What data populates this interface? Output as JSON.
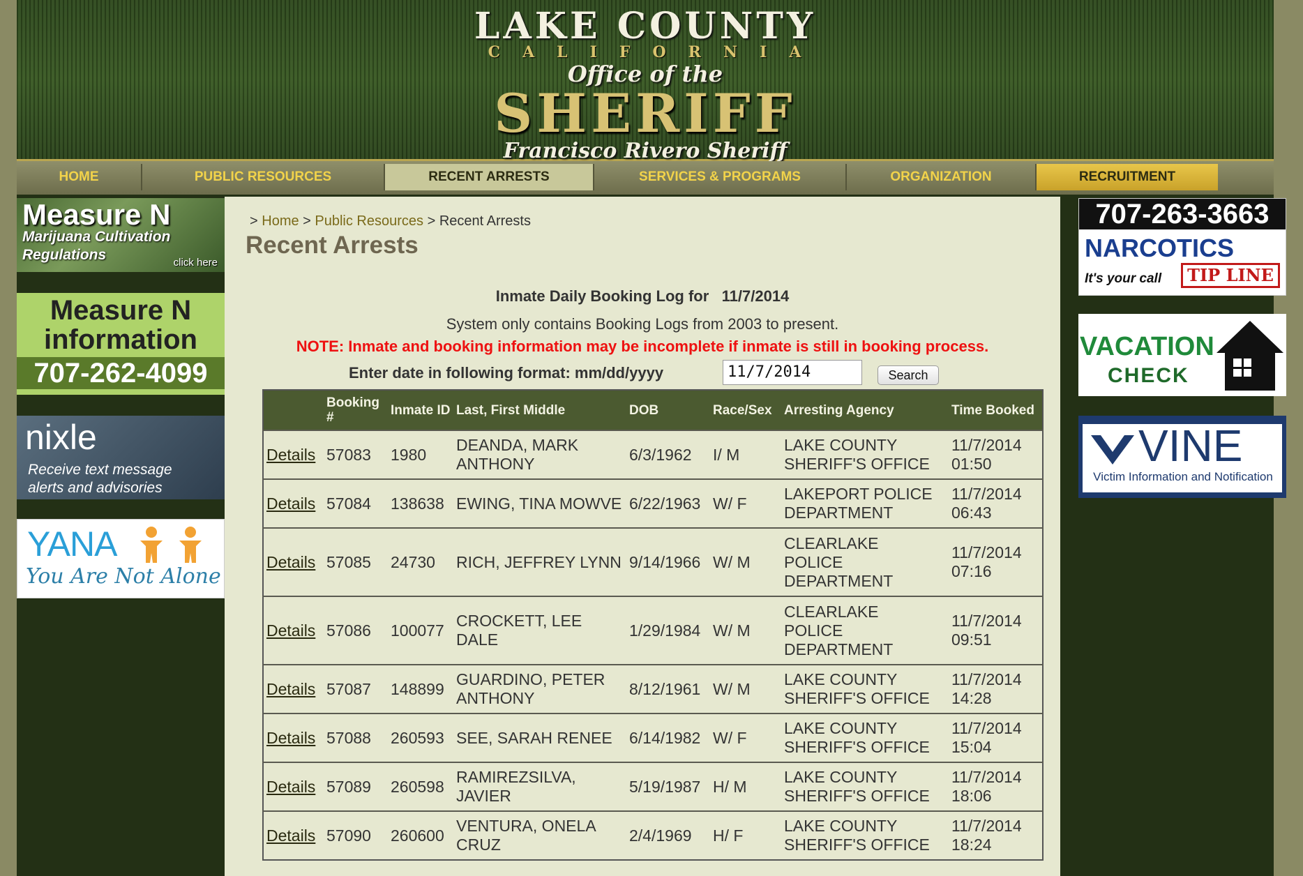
{
  "header": {
    "logo_line1": "LAKE COUNTY",
    "logo_line2": "CALIFORNIA",
    "logo_line3": "Office of the",
    "logo_line4": "SHERIFF",
    "logo_line5": "Francisco Rivero Sheriff"
  },
  "nav": {
    "items": [
      "HOME",
      "PUBLIC RESOURCES",
      "RECENT ARRESTS",
      "SERVICES & PROGRAMS",
      "ORGANIZATION",
      "RECRUITMENT"
    ],
    "active": "RECENT ARRESTS"
  },
  "ads_left": {
    "measure_n": {
      "title": "Measure N",
      "line1": "Marijuana Cultivation",
      "line2": "Regulations",
      "cta": "click here"
    },
    "measure_n_info": {
      "line1": "Measure N",
      "line2": "information",
      "phone": "707-262-4099"
    },
    "nixle": {
      "brand": "nixle",
      "line1": "Receive text message",
      "line2": "alerts and advisories"
    },
    "yana": {
      "brand": "YANA",
      "tagline": "You Are Not Alone"
    }
  },
  "ads_right": {
    "narcotics": {
      "phone": "707-263-3663",
      "title": "NARCOTICS",
      "tagline": "It's your call",
      "badge": "TIP LINE"
    },
    "vacation": {
      "line1": "VACATION",
      "line2": "CHECK"
    },
    "vine": {
      "brand": "VINE",
      "tagline": "Victim Information and Notification"
    }
  },
  "breadcrumb": {
    "home": "Home",
    "public_resources": "Public Resources",
    "current": "Recent Arrests"
  },
  "page_title": "Recent Arrests",
  "log": {
    "title_prefix": "Inmate Daily Booking Log for",
    "date": "11/7/2014",
    "subtitle": "System only contains Booking Logs from 2003 to present.",
    "note": "NOTE: Inmate and booking information may be incomplete if inmate is still in booking process.",
    "date_label": "Enter date in following format: mm/dd/yyyy",
    "date_input_value": "11/7/2014",
    "search_label": "Search"
  },
  "table": {
    "headers": [
      "",
      "Booking #",
      "Inmate ID",
      "Last, First Middle",
      "DOB",
      "Race/Sex",
      "Arresting Agency",
      "Time Booked"
    ],
    "rows": [
      {
        "link": "Details",
        "booking": "57083",
        "inmate_id": "1980",
        "name": "DEANDA, MARK ANTHONY",
        "dob": "6/3/1962",
        "race_sex": "I/ M",
        "agency": "LAKE COUNTY SHERIFF'S OFFICE",
        "date": "11/7/2014",
        "time": "01:50"
      },
      {
        "link": "Details",
        "booking": "57084",
        "inmate_id": "138638",
        "name": "EWING, TINA MOWVE",
        "dob": "6/22/1963",
        "race_sex": "W/ F",
        "agency": "LAKEPORT POLICE DEPARTMENT",
        "date": "11/7/2014",
        "time": "06:43"
      },
      {
        "link": "Details",
        "booking": "57085",
        "inmate_id": "24730",
        "name": "RICH, JEFFREY LYNN",
        "dob": "9/14/1966",
        "race_sex": "W/ M",
        "agency": "CLEARLAKE POLICE DEPARTMENT",
        "date": "11/7/2014",
        "time": "07:16"
      },
      {
        "link": "Details",
        "booking": "57086",
        "inmate_id": "100077",
        "name": "CROCKETT, LEE DALE",
        "dob": "1/29/1984",
        "race_sex": "W/ M",
        "agency": "CLEARLAKE POLICE DEPARTMENT",
        "date": "11/7/2014",
        "time": "09:51"
      },
      {
        "link": "Details",
        "booking": "57087",
        "inmate_id": "148899",
        "name": "GUARDINO, PETER ANTHONY",
        "dob": "8/12/1961",
        "race_sex": "W/ M",
        "agency": "LAKE COUNTY SHERIFF'S OFFICE",
        "date": "11/7/2014",
        "time": "14:28"
      },
      {
        "link": "Details",
        "booking": "57088",
        "inmate_id": "260593",
        "name": "SEE, SARAH RENEE",
        "dob": "6/14/1982",
        "race_sex": "W/ F",
        "agency": "LAKE COUNTY SHERIFF'S OFFICE",
        "date": "11/7/2014",
        "time": "15:04"
      },
      {
        "link": "Details",
        "booking": "57089",
        "inmate_id": "260598",
        "name": "RAMIREZSILVA, JAVIER",
        "dob": "5/19/1987",
        "race_sex": "H/ M",
        "agency": "LAKE COUNTY SHERIFF'S OFFICE",
        "date": "11/7/2014",
        "time": "18:06"
      },
      {
        "link": "Details",
        "booking": "57090",
        "inmate_id": "260600",
        "name": "VENTURA, ONELA CRUZ",
        "dob": "2/4/1969",
        "race_sex": "H/ F",
        "agency": "LAKE COUNTY SHERIFF'S OFFICE",
        "date": "11/7/2014",
        "time": "18:24"
      }
    ]
  },
  "colors": {
    "header_green": "#2f4a1e",
    "nav_text": "#f2d34a",
    "table_header": "#4b5a30",
    "content_bg": "#e6e8d0",
    "note_red": "#ee1111",
    "link_gold": "#7a6a1a"
  }
}
